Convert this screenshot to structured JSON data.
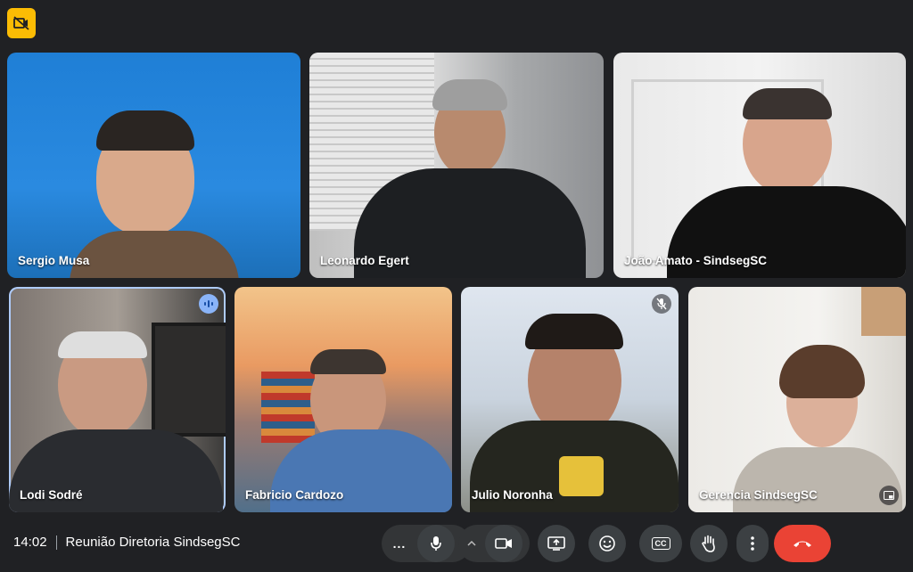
{
  "meeting": {
    "time": "14:02",
    "title": "Reunião Diretoria SindsegSC"
  },
  "participants": [
    {
      "name": "Sergio Musa"
    },
    {
      "name": "Leonardo Egert"
    },
    {
      "name": "João Amato - SindsegSC"
    },
    {
      "name": "Lodi Sodré",
      "status": "speaking"
    },
    {
      "name": "Fabricio Cardozo"
    },
    {
      "name": "Julio Noronha",
      "status": "muted"
    },
    {
      "name": "Gerencia SindsegSC"
    }
  ],
  "controls": {
    "more_dots_label": "...",
    "mic": "mic-icon",
    "camera": "camera-icon",
    "present": "present-screen-icon",
    "reactions": "emoji-icon",
    "captions": "captions-icon",
    "captions_label": "CC",
    "raise_hand": "raise-hand-icon",
    "more_options": "more-vert-icon",
    "end_call": "end-call-icon"
  },
  "colors": {
    "background": "#202124",
    "end_call": "#ea4335",
    "badge": "#fbbc04",
    "speaking": "#8ab4f8"
  }
}
